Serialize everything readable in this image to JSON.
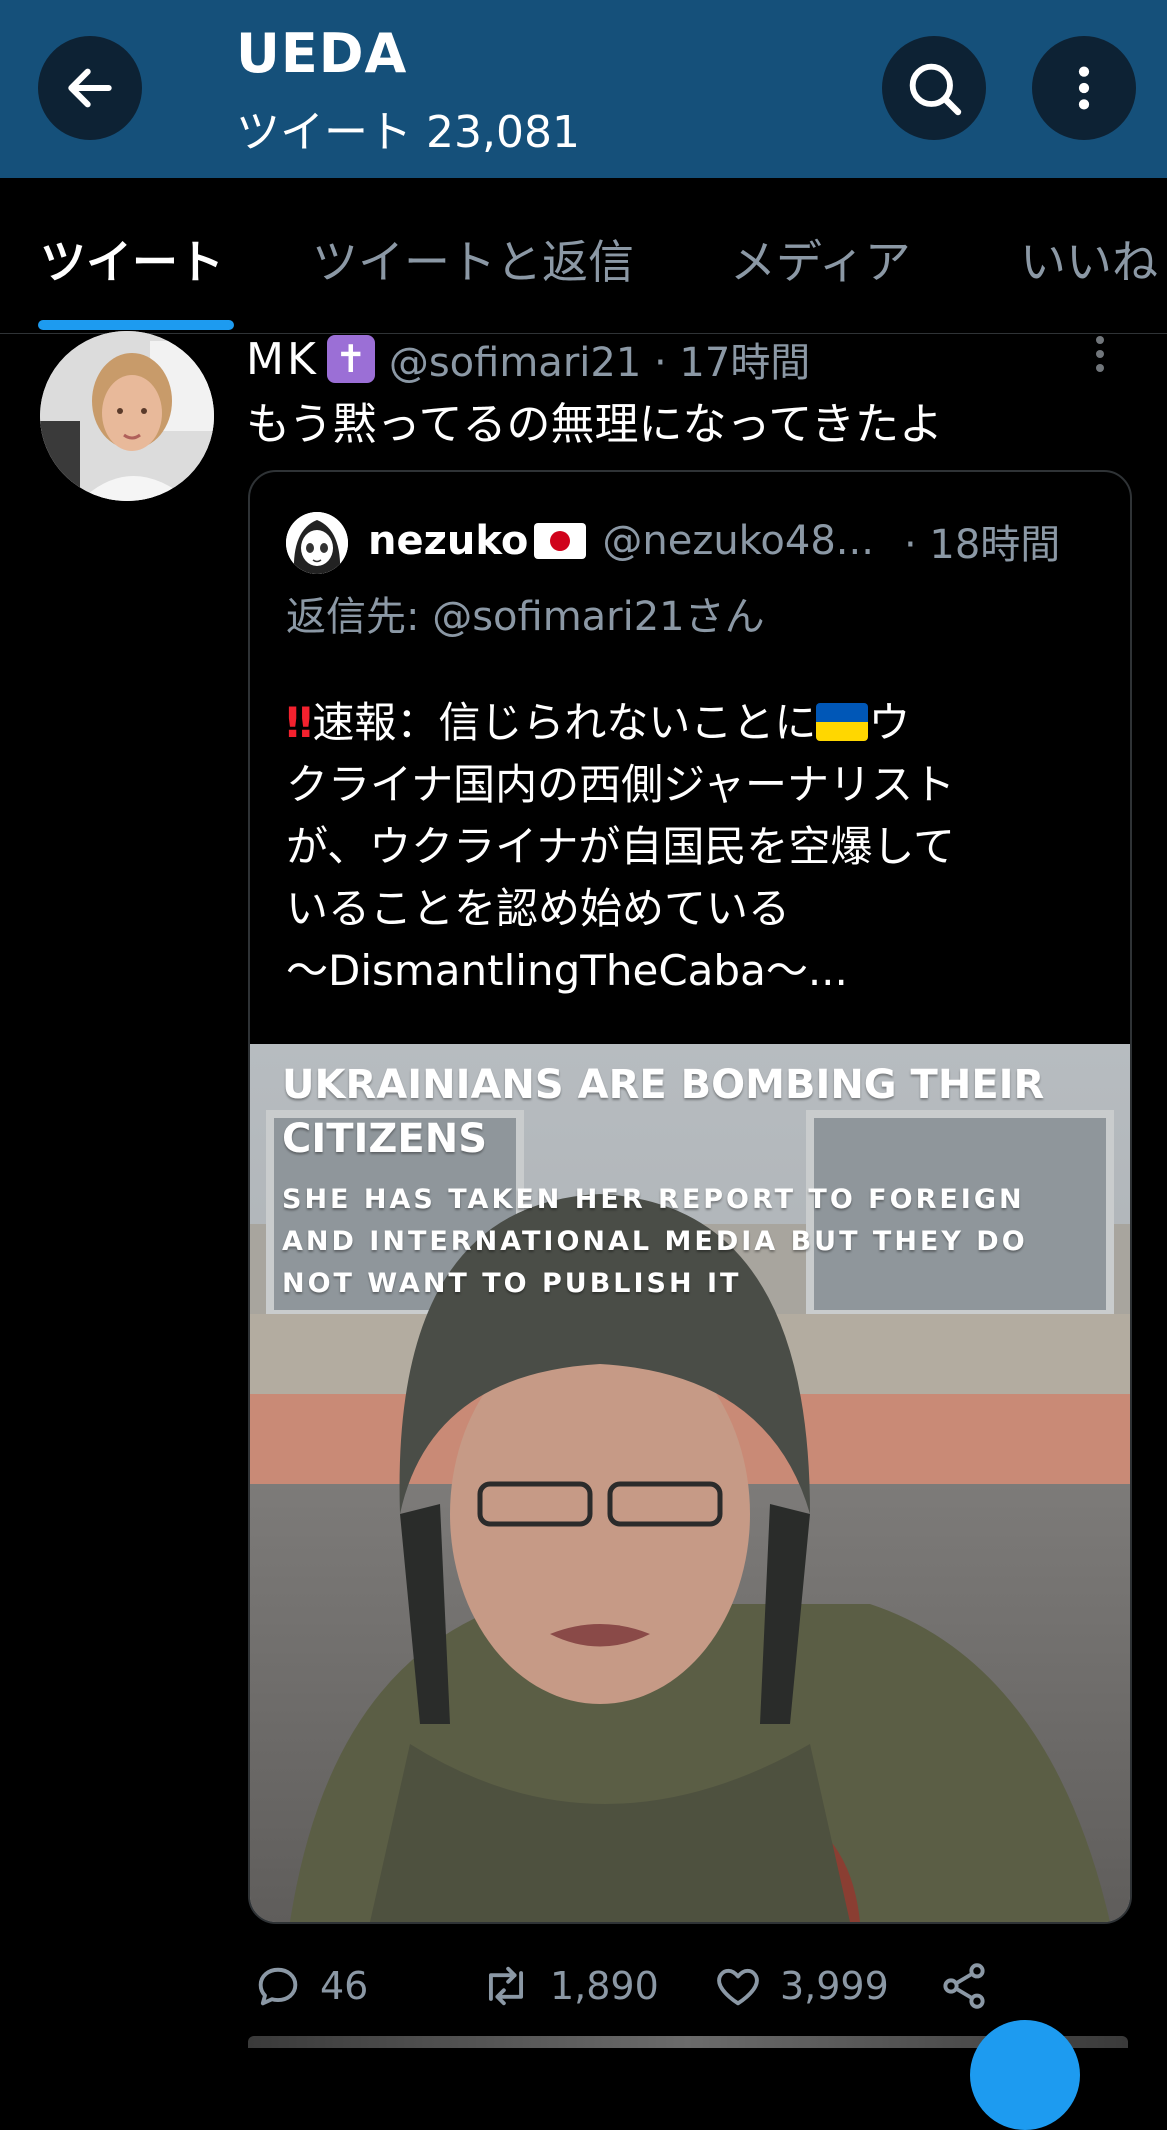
{
  "header": {
    "title": "UEDA",
    "subtitle": "ツイート 23,081",
    "bg_color": "#15507a"
  },
  "tabs": [
    {
      "label": "ツイート",
      "active": true
    },
    {
      "label": "ツイートと返信",
      "active": false
    },
    {
      "label": "メディア",
      "active": false
    },
    {
      "label": "いいね",
      "active": false
    }
  ],
  "tweet": {
    "author_name": "MK",
    "badge": "✝",
    "handle_time": "@sofimari21 · 17時間",
    "text": "もう黙ってるの無理になってきたよ",
    "quote": {
      "author_name": "nezuko",
      "handle": "@nezuko48...",
      "time": "· 18時間",
      "reply_to": "返信先: @sofimari21さん",
      "bang": "‼",
      "body_lines": [
        "速報：信じられないことに",
        "ウ",
        "クライナ国内の西側ジャーナリスト",
        "が、ウクライナが自国民を空爆して",
        "いることを認め始めている",
        "〜DismantlingTheCaba〜..."
      ],
      "media": {
        "caption_line1": "UKRAINIANS ARE BOMBING THEIR",
        "caption_line2": "CITIZENS",
        "caption_line3": "SHE HAS TAKEN HER REPORT TO FOREIGN",
        "caption_line4": "AND INTERNATIONAL MEDIA BUT THEY DO",
        "caption_line5": "NOT WANT TO PUBLISH IT"
      }
    },
    "stats": {
      "replies": "46",
      "retweets": "1,890",
      "likes": "3,999"
    }
  },
  "accent_color": "#1d9bf0"
}
